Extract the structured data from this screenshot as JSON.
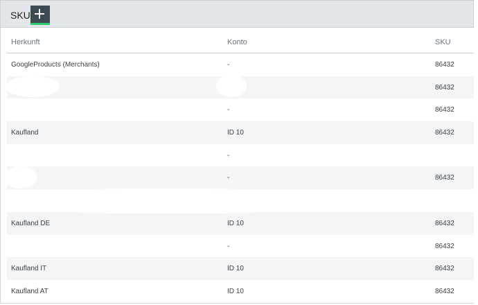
{
  "header": {
    "title": "SKU",
    "add_button_icon": "plus-icon"
  },
  "colors": {
    "header_bg": "#e3e6ea",
    "button_bg": "#3e4a52",
    "button_accent": "#2ecc71",
    "row_alt_bg": "#f3f5f7"
  },
  "table": {
    "columns": [
      "Herkunft",
      "Konto",
      "SKU"
    ],
    "rows": [
      [
        "GoogleProducts (Merchants)",
        "-",
        "86432"
      ],
      [
        "",
        "",
        "86432"
      ],
      [
        "",
        "-",
        "86432"
      ],
      [
        "Kaufland",
        "ID 10",
        "86432"
      ],
      [
        "",
        "-",
        ""
      ],
      [
        "",
        "-",
        "86432"
      ],
      [
        "",
        "",
        ""
      ],
      [
        "Kaufland DE",
        "ID 10",
        "86432"
      ],
      [
        "",
        "-",
        "86432"
      ],
      [
        "Kaufland IT",
        "ID 10",
        "86432"
      ],
      [
        "Kaufland AT",
        "ID 10",
        "86432"
      ]
    ]
  }
}
